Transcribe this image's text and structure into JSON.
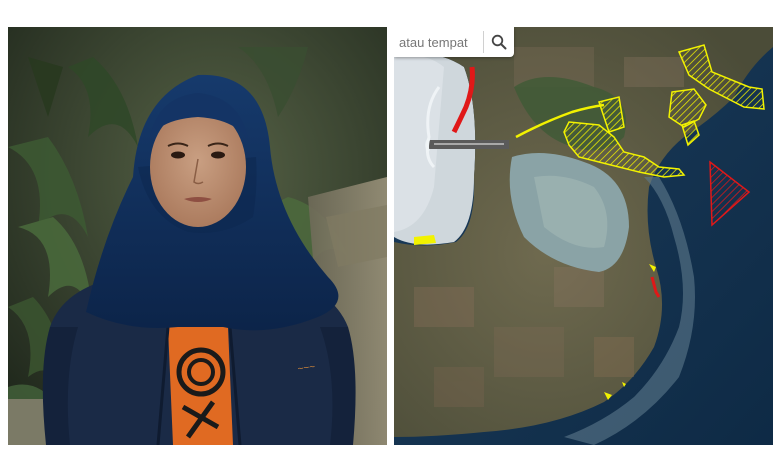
{
  "photo": {
    "subject": "woman-in-hijab-portrait",
    "colors": {
      "hijab": "#0f2c55",
      "jacket": "#1b2a45",
      "shirt": "#e06a22",
      "foliage": "#2f3b2a"
    }
  },
  "map": {
    "search": {
      "placeholder": "atau tempat",
      "icon": "search-icon"
    },
    "overlays": {
      "yellow_color": "#f2f200",
      "red_color": "#e01818"
    }
  }
}
